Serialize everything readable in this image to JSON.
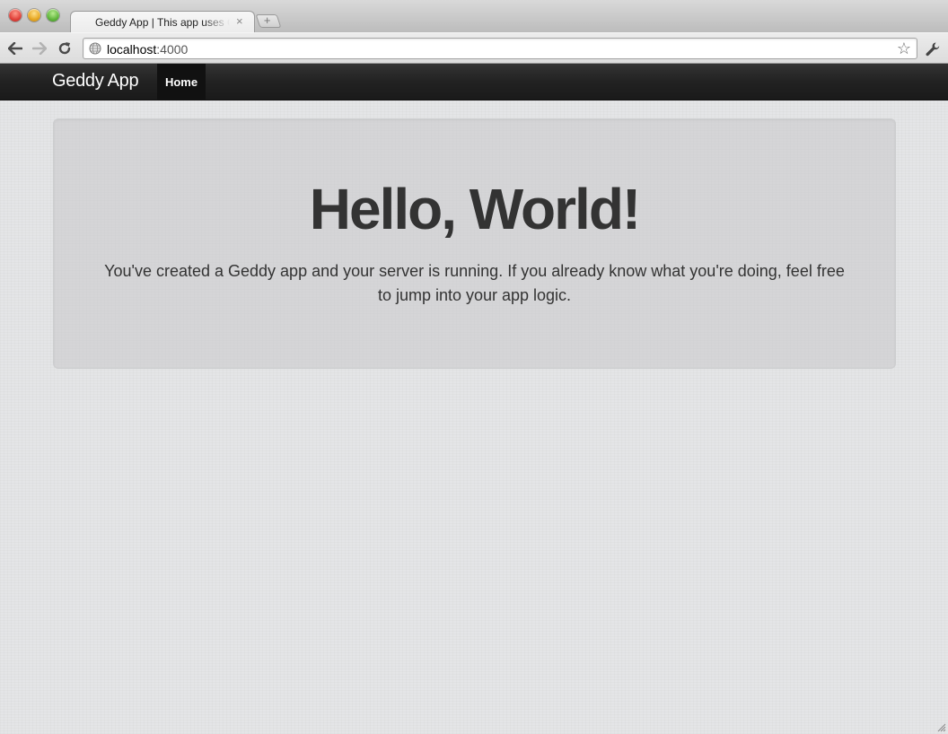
{
  "browser": {
    "tab": {
      "title": "Geddy App | This app uses Geddy",
      "close_glyph": "×"
    },
    "new_tab_glyph": "+",
    "address_bar": {
      "host": "localhost",
      "port": ":4000"
    },
    "icons": {
      "back": "back-arrow-icon",
      "forward": "forward-arrow-icon",
      "reload": "reload-icon",
      "site": "globe-icon",
      "bookmark": "star-icon",
      "menu": "wrench-icon"
    },
    "bookmark_glyph": "☆"
  },
  "app": {
    "navbar": {
      "brand": "Geddy App",
      "items": [
        {
          "label": "Home",
          "active": true
        }
      ]
    },
    "hero": {
      "heading": "Hello, World!",
      "text": "You've created a Geddy app and your server is running. If you already know what you're doing, feel free to jump into your app logic."
    }
  },
  "colors": {
    "navbar_bg": "#222222",
    "active_nav_bg": "#111111",
    "page_bg": "#e4e5e7",
    "hero_text": "#333333"
  }
}
